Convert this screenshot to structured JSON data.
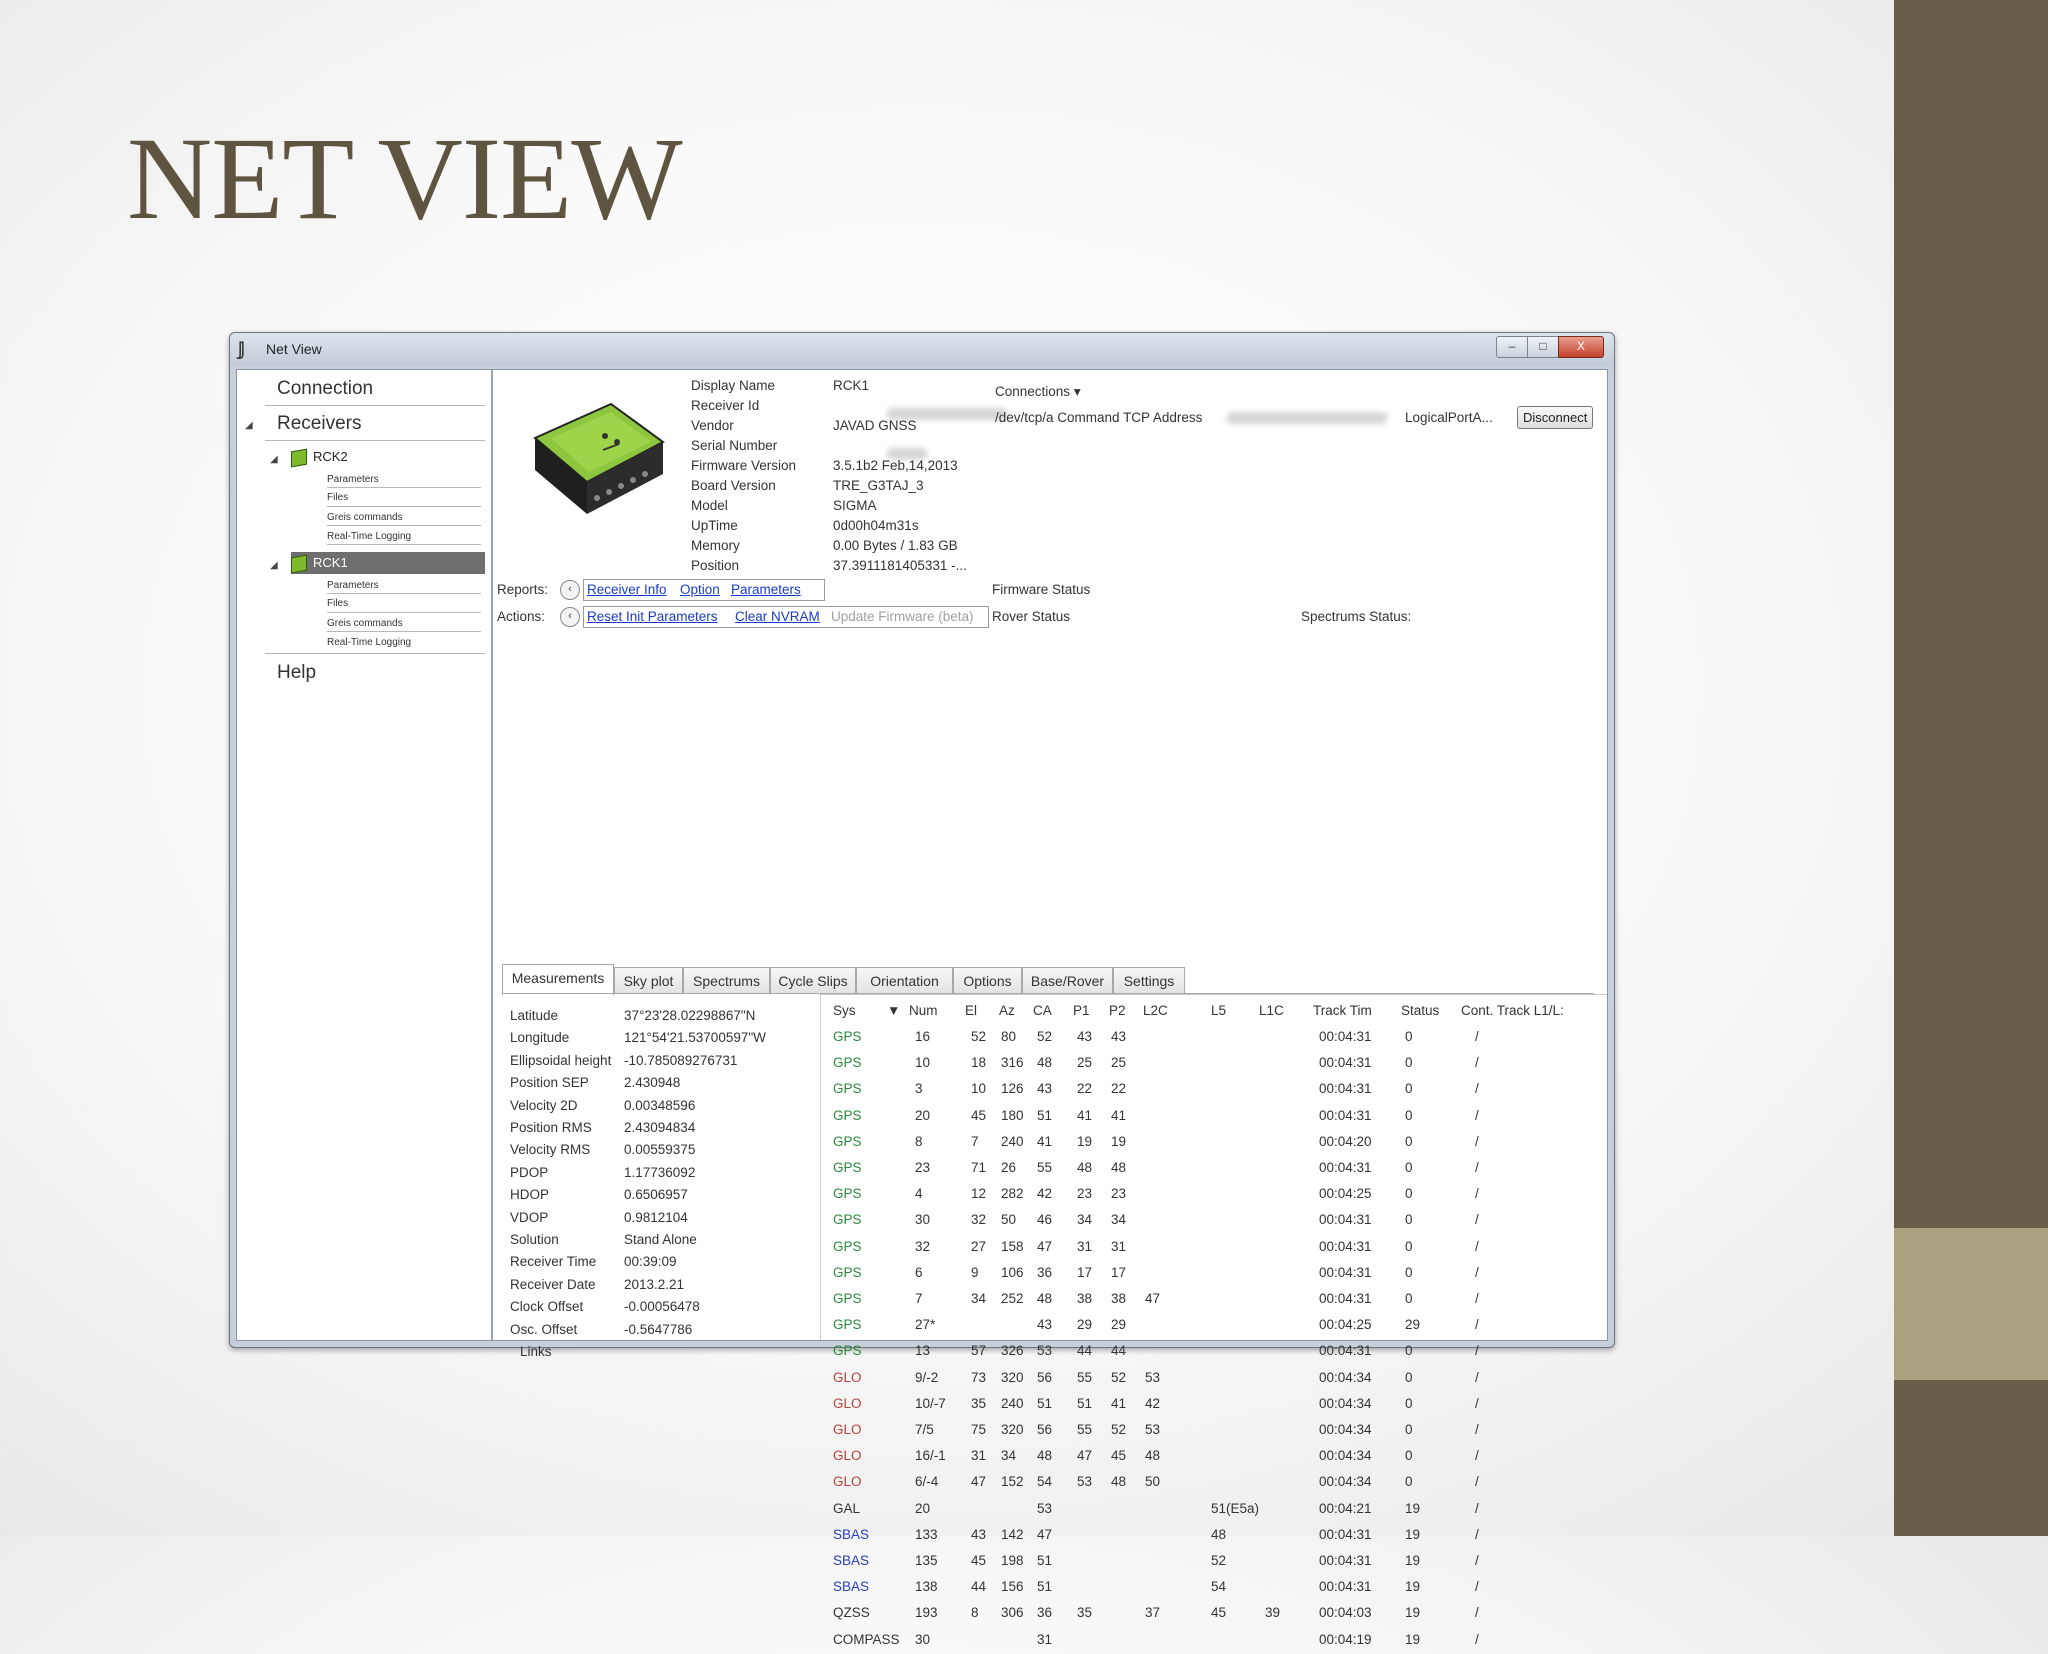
{
  "slide": {
    "title": "NET VIEW"
  },
  "colors": {
    "band": "#695e49",
    "accent": "#a9a27f",
    "title": "#5e5540"
  },
  "window": {
    "title": "Net View",
    "controls": {
      "minimize": "–",
      "maximize": "□",
      "close": "X"
    }
  },
  "sidebar": {
    "connection": "Connection",
    "receivers": "Receivers",
    "help": "Help",
    "tree": [
      {
        "name": "RCK2",
        "items": [
          "Parameters",
          "Files",
          "Greis commands",
          "Real-Time Logging"
        ]
      },
      {
        "name": "RCK1",
        "items": [
          "Parameters",
          "Files",
          "Greis commands",
          "Real-Time Logging"
        ]
      }
    ]
  },
  "receiver_info": {
    "labels": [
      "Display Name",
      "Receiver Id",
      "Vendor",
      "Serial Number",
      "Firmware Version",
      "Board Version",
      "Model",
      "UpTime",
      "Memory",
      "Position"
    ],
    "values": [
      "RCK1",
      "",
      "JAVAD GNSS",
      "",
      "3.5.1b2 Feb,14,2013",
      "TRE_G3TAJ_3",
      "SIGMA",
      "0d00h04m31s",
      "0.00 Bytes / 1.83 GB",
      "37.3911181405331 -..."
    ]
  },
  "connections": {
    "label": "Connections",
    "path": "/dev/tcp/a Command TCP Address",
    "port": "LogicalPortA...",
    "disconnect": "Disconnect"
  },
  "reports": {
    "label": "Reports:",
    "links": [
      "Receiver Info",
      "Option",
      "Parameters"
    ]
  },
  "actions": {
    "label": "Actions:",
    "links": [
      "Reset Init Parameters",
      "Clear NVRAM"
    ],
    "disabled_link": "Update Firmware (beta)"
  },
  "status": {
    "firmware": "Firmware Status",
    "rover": "Rover Status",
    "spectrums": "Spectrums Status:"
  },
  "tabs": [
    "Measurements",
    "Sky plot",
    "Spectrums",
    "Cycle Slips",
    "Orientation",
    "Options",
    "Base/Rover",
    "Settings"
  ],
  "measurements": [
    {
      "label": "Latitude",
      "value": "37°23'28.02298867\"N"
    },
    {
      "label": "Longitude",
      "value": "121°54'21.53700597\"W"
    },
    {
      "label": "Ellipsoidal height",
      "value": "-10.785089276731"
    },
    {
      "label": "Position SEP",
      "value": "2.430948"
    },
    {
      "label": "Velocity 2D",
      "value": "0.00348596"
    },
    {
      "label": "Position RMS",
      "value": "2.43094834"
    },
    {
      "label": "Velocity RMS",
      "value": "0.00559375"
    },
    {
      "label": "PDOP",
      "value": "1.17736092"
    },
    {
      "label": "HDOP",
      "value": "0.6506957"
    },
    {
      "label": "VDOP",
      "value": "0.9812104"
    },
    {
      "label": "Solution",
      "value": "Stand Alone"
    },
    {
      "label": "Receiver Time",
      "value": "00:39:09"
    },
    {
      "label": "Receiver Date",
      "value": "2013.2.21"
    },
    {
      "label": "Clock Offset",
      "value": "-0.00056478"
    },
    {
      "label": "Osc. Offset",
      "value": "-0.5647786"
    },
    {
      "label": "Links",
      "value": ""
    }
  ],
  "sat_table": {
    "headers": [
      "Sys",
      "▼",
      "Num",
      "El",
      "Az",
      "CA",
      "P1",
      "P2",
      "L2C",
      "L5",
      "L1C",
      "Track Tim",
      "Status",
      "Cont. Track L1/L:"
    ],
    "rows": [
      [
        "GPS",
        "16",
        "52",
        "80",
        "52",
        "43",
        "43",
        "",
        "",
        "",
        "00:04:31",
        "0",
        "/"
      ],
      [
        "GPS",
        "10",
        "18",
        "316",
        "48",
        "25",
        "25",
        "",
        "",
        "",
        "00:04:31",
        "0",
        "/"
      ],
      [
        "GPS",
        "3",
        "10",
        "126",
        "43",
        "22",
        "22",
        "",
        "",
        "",
        "00:04:31",
        "0",
        "/"
      ],
      [
        "GPS",
        "20",
        "45",
        "180",
        "51",
        "41",
        "41",
        "",
        "",
        "",
        "00:04:31",
        "0",
        "/"
      ],
      [
        "GPS",
        "8",
        "7",
        "240",
        "41",
        "19",
        "19",
        "",
        "",
        "",
        "00:04:20",
        "0",
        "/"
      ],
      [
        "GPS",
        "23",
        "71",
        "26",
        "55",
        "48",
        "48",
        "",
        "",
        "",
        "00:04:31",
        "0",
        "/"
      ],
      [
        "GPS",
        "4",
        "12",
        "282",
        "42",
        "23",
        "23",
        "",
        "",
        "",
        "00:04:25",
        "0",
        "/"
      ],
      [
        "GPS",
        "30",
        "32",
        "50",
        "46",
        "34",
        "34",
        "",
        "",
        "",
        "00:04:31",
        "0",
        "/"
      ],
      [
        "GPS",
        "32",
        "27",
        "158",
        "47",
        "31",
        "31",
        "",
        "",
        "",
        "00:04:31",
        "0",
        "/"
      ],
      [
        "GPS",
        "6",
        "9",
        "106",
        "36",
        "17",
        "17",
        "",
        "",
        "",
        "00:04:31",
        "0",
        "/"
      ],
      [
        "GPS",
        "7",
        "34",
        "252",
        "48",
        "38",
        "38",
        "47",
        "",
        "",
        "00:04:31",
        "0",
        "/"
      ],
      [
        "GPS",
        "27*",
        "",
        "",
        "43",
        "29",
        "29",
        "",
        "",
        "",
        "00:04:25",
        "29",
        "/"
      ],
      [
        "GPS",
        "13",
        "57",
        "326",
        "53",
        "44",
        "44",
        "",
        "",
        "",
        "00:04:31",
        "0",
        "/"
      ],
      [
        "GLO",
        "9/-2",
        "73",
        "320",
        "56",
        "55",
        "52",
        "53",
        "",
        "",
        "00:04:34",
        "0",
        "/"
      ],
      [
        "GLO",
        "10/-7",
        "35",
        "240",
        "51",
        "51",
        "41",
        "42",
        "",
        "",
        "00:04:34",
        "0",
        "/"
      ],
      [
        "GLO",
        "7/5",
        "75",
        "320",
        "56",
        "55",
        "52",
        "53",
        "",
        "",
        "00:04:34",
        "0",
        "/"
      ],
      [
        "GLO",
        "16/-1",
        "31",
        "34",
        "48",
        "47",
        "45",
        "48",
        "",
        "",
        "00:04:34",
        "0",
        "/"
      ],
      [
        "GLO",
        "6/-4",
        "47",
        "152",
        "54",
        "53",
        "48",
        "50",
        "",
        "",
        "00:04:34",
        "0",
        "/"
      ],
      [
        "GAL",
        "20",
        "",
        "",
        "53",
        "",
        "",
        "",
        "51(E5a)",
        "",
        "00:04:21",
        "19",
        "/"
      ],
      [
        "SBAS",
        "133",
        "43",
        "142",
        "47",
        "",
        "",
        "",
        "48",
        "",
        "00:04:31",
        "19",
        "/"
      ],
      [
        "SBAS",
        "135",
        "45",
        "198",
        "51",
        "",
        "",
        "",
        "52",
        "",
        "00:04:31",
        "19",
        "/"
      ],
      [
        "SBAS",
        "138",
        "44",
        "156",
        "51",
        "",
        "",
        "",
        "54",
        "",
        "00:04:31",
        "19",
        "/"
      ],
      [
        "QZSS",
        "193",
        "8",
        "306",
        "36",
        "35",
        "",
        "37",
        "45",
        "39",
        "00:04:03",
        "19",
        "/"
      ],
      [
        "COMPASS",
        "30",
        "",
        "",
        "31",
        "",
        "",
        "",
        "",
        "",
        "00:04:19",
        "19",
        "/"
      ]
    ]
  }
}
